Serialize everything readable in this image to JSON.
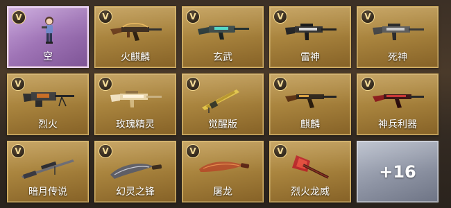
{
  "colors": {
    "gold_tile": "#a9843e",
    "purple_tile": "#9f74b6",
    "more_tile": "#8d93a3",
    "v_badge_border": "#f5d789"
  },
  "items": [
    {
      "label": "空",
      "badge": "V",
      "image": "character-figure-icon",
      "style": "purple"
    },
    {
      "label": "火麒麟",
      "badge": "V",
      "image": "assault-rifle-icon",
      "style": "gold"
    },
    {
      "label": "玄武",
      "badge": "V",
      "image": "energy-rifle-icon",
      "style": "gold"
    },
    {
      "label": "雷神",
      "badge": "V",
      "image": "carbine-rifle-icon",
      "style": "gold"
    },
    {
      "label": "死神",
      "badge": "V",
      "image": "carbine-rifle-icon",
      "style": "gold"
    },
    {
      "label": "烈火",
      "badge": "V",
      "image": "machine-gun-icon",
      "style": "gold"
    },
    {
      "label": "玫瑰精灵",
      "badge": "V",
      "image": "carbine-rifle-icon",
      "style": "gold"
    },
    {
      "label": "觉醒版",
      "badge": "V",
      "image": "gatling-gun-icon",
      "style": "gold"
    },
    {
      "label": "麒麟",
      "badge": "V",
      "image": "assault-rifle-icon",
      "style": "gold"
    },
    {
      "label": "神兵利器",
      "badge": "V",
      "image": "assault-rifle-icon",
      "style": "gold"
    },
    {
      "label": "暗月传说",
      "badge": "V",
      "image": "sniper-rifle-icon",
      "style": "gold"
    },
    {
      "label": "幻灵之锋",
      "badge": "V",
      "image": "kukri-blade-icon",
      "style": "gold"
    },
    {
      "label": "屠龙",
      "badge": "V",
      "image": "curved-blade-icon",
      "style": "gold"
    },
    {
      "label": "烈火龙威",
      "badge": "V",
      "image": "axe-icon",
      "style": "gold"
    }
  ],
  "more": {
    "count_label": "+16"
  }
}
